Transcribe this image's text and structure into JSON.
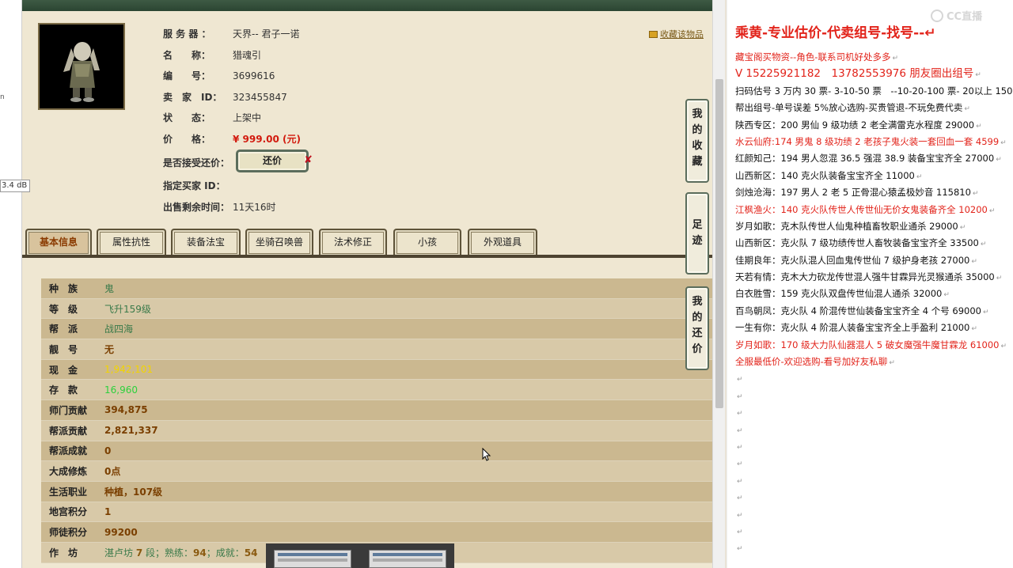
{
  "left_edge": {
    "db_label": "3.4 dB",
    "stub": "n"
  },
  "favorite_link": "收藏该物品",
  "info": [
    {
      "label": "服 务 器 ：",
      "value": "天界-- 君子一诺"
    },
    {
      "label": "名　　称：",
      "value": "猎魂引"
    },
    {
      "label": "编　　号：",
      "value": "3699616"
    },
    {
      "label": "卖　家　ID：",
      "value": "323455847"
    },
    {
      "label": "状　　态：",
      "value": "上架中"
    },
    {
      "label": "价　　格：",
      "value": "¥ 999.00 (元)"
    },
    {
      "label": "是否接受还价：",
      "value": ""
    },
    {
      "label": "指定买家 ID：",
      "value": ""
    },
    {
      "label": "出售剩余时间：",
      "value": "11天16时"
    }
  ],
  "haggle_button": "还价",
  "haggle_x": "✘",
  "tabs": [
    "基本信息",
    "属性抗性",
    "装备法宝",
    "坐骑召唤兽",
    "法术修正",
    "小孩",
    "外观道具"
  ],
  "stats": [
    {
      "key": "种　族",
      "value": "鬼",
      "style": "green"
    },
    {
      "key": "等　级",
      "value": "飞升159级",
      "style": "green"
    },
    {
      "key": "帮　派",
      "value": "战四海",
      "style": "green"
    },
    {
      "key": "靓　号",
      "value": "无",
      "style": "brown"
    },
    {
      "key": "现　金",
      "value": "1,942,101",
      "style": "yellow"
    },
    {
      "key": "存　款",
      "value": "16,960",
      "style": "lime"
    },
    {
      "key": "师门贡献",
      "value": "394,875",
      "style": "brown"
    },
    {
      "key": "帮派贡献",
      "value": "2,821,337",
      "style": "brown"
    },
    {
      "key": "帮派成就",
      "value": "0",
      "style": "brown"
    },
    {
      "key": "大成修炼",
      "value": "0点",
      "style": "brown"
    },
    {
      "key": "生活职业",
      "value": "种植，107级",
      "style": "brown"
    },
    {
      "key": "地宫积分",
      "value": "1",
      "style": "brown"
    },
    {
      "key": "师徒积分",
      "value": "99200",
      "style": "brown"
    }
  ],
  "workshop": {
    "key": "作　坊",
    "name": "湛卢坊",
    "level_num": "7",
    "level_unit": "段；熟练：",
    "skill": "94",
    "skill_sep": "；成就：",
    "achieve": "54"
  },
  "side_buttons": [
    {
      "label": "我的收藏"
    },
    {
      "label": "足迹"
    },
    {
      "label": "我的还价"
    }
  ],
  "note": {
    "watermark": "CC直播",
    "title": "乘黄-专业估价-代卖组号-找号--",
    "return_mark": "↵",
    "lines": [
      {
        "text": "藏宝阁买物资--角色-联系司机好处多多",
        "style": "red"
      },
      {
        "text": "V 15225921182　13782553976 朋友圈出组号",
        "style": "red big"
      },
      {
        "text": "扫码估号 3 万内 30 票- 3-10-50 票　--10-20-100 票- 20以上 150",
        "style": ""
      },
      {
        "text": "帮出组号-单号误差 5%放心选购-买贵管退-不玩免费代卖",
        "style": ""
      },
      {
        "text": "陕西专区：200 男仙 9 级功绩 2 老全满雷克水程度 29000",
        "style": ""
      },
      {
        "text": "水云仙府:174 男鬼 8 级功绩 2 老孩子鬼火装一套回血一套 4599",
        "style": "red"
      },
      {
        "text": "红颜知己：194 男人忽混 36.5 强混 38.9 装备宝宝齐全 27000",
        "style": ""
      },
      {
        "text": "山西新区：140 克火队装备宝宝齐全 11000",
        "style": ""
      },
      {
        "text": "剑烛沧海：197 男人 2 老 5 正骨混心猿孟极妙音 115810",
        "style": ""
      },
      {
        "text": "江枫渔火：140 克火队传世人传世仙无价女鬼装备齐全 10200",
        "style": "red"
      },
      {
        "text": "岁月如歌：克木队传世人仙鬼种植畜牧职业通杀 29000",
        "style": ""
      },
      {
        "text": "山西新区：克火队 7 级功绩传世人畜牧装备宝宝齐全 33500",
        "style": ""
      },
      {
        "text": "佳期良年：克火队混人回血鬼传世仙 7 级护身老孩 27000",
        "style": ""
      },
      {
        "text": "天若有情：克木大力砍龙传世混人强牛甘霖异光灵猴通杀 35000",
        "style": ""
      },
      {
        "text": "白衣胜雪：159 克火队双盘传世仙混人通杀 32000",
        "style": ""
      },
      {
        "text": "百鸟朝凤：克火队 4 阶混传世仙装备宝宝齐全 4 个号 69000",
        "style": ""
      },
      {
        "text": "一生有你：克火队 4 阶混人装备宝宝齐全上手盈利 21000",
        "style": ""
      },
      {
        "text": "岁月如歌：170 级大力队仙器混人 5 破女魔强牛魔甘霖龙 61000",
        "style": "red"
      },
      {
        "text": "全服最低价-欢迎选购-看号加好友私聊",
        "style": "red"
      }
    ]
  }
}
